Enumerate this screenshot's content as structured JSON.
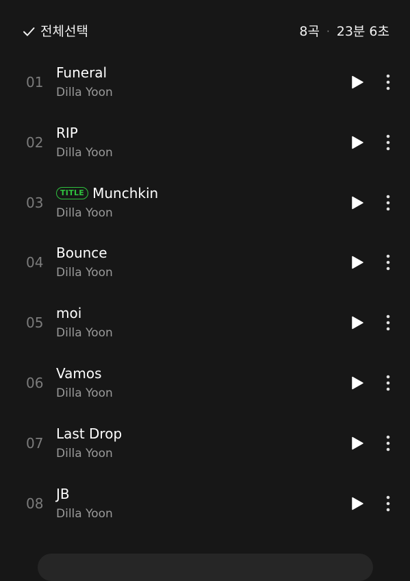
{
  "header": {
    "select_all_label": "전체선택",
    "track_count": "8곡",
    "separator": "·",
    "total_duration": "23분 6초"
  },
  "badge_label": "TITLE",
  "colors": {
    "background": "#171717",
    "accent_green": "#2fc33f",
    "text_primary": "#ffffff",
    "text_secondary": "#9a9a9a",
    "text_index": "#7c7c7c"
  },
  "tracks": [
    {
      "index": "01",
      "title": "Funeral",
      "artist": "Dilla Yoon",
      "is_title": false
    },
    {
      "index": "02",
      "title": "RIP",
      "artist": "Dilla Yoon",
      "is_title": false
    },
    {
      "index": "03",
      "title": "Munchkin",
      "artist": "Dilla Yoon",
      "is_title": true
    },
    {
      "index": "04",
      "title": "Bounce",
      "artist": "Dilla Yoon",
      "is_title": false
    },
    {
      "index": "05",
      "title": "moi",
      "artist": "Dilla Yoon",
      "is_title": false
    },
    {
      "index": "06",
      "title": "Vamos",
      "artist": "Dilla Yoon",
      "is_title": false
    },
    {
      "index": "07",
      "title": "Last Drop",
      "artist": "Dilla Yoon",
      "is_title": false
    },
    {
      "index": "08",
      "title": "JB",
      "artist": "Dilla Yoon",
      "is_title": false
    }
  ],
  "icons": {
    "select_all": "check-icon",
    "play": "play-icon",
    "more": "more-vertical-icon"
  }
}
